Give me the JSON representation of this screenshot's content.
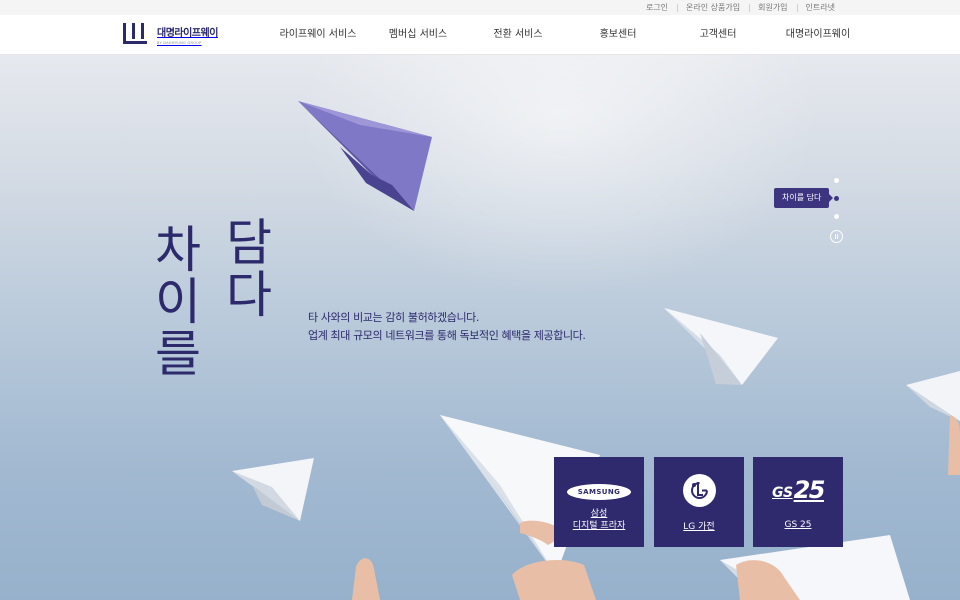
{
  "util_links": [
    "로그인",
    "온라인 상품가입",
    "회원가입",
    "인트라넷"
  ],
  "logo": {
    "text": "대명라이프웨이",
    "sub": "BY DAEMYUNG GROUP"
  },
  "gnb": [
    "라이프웨이 서비스",
    "멤버십 서비스",
    "전환 서비스",
    "홍보센터",
    "고객센터",
    "대명라이프웨이"
  ],
  "hero": {
    "title_right": [
      "담",
      "다"
    ],
    "title_left": [
      "차",
      "이",
      "를"
    ],
    "desc_line1": "타 사와의 비교는 감히 불허하겠습니다.",
    "desc_line2": "업계 최대 규모의 네트워크를 통해 독보적인 혜택을 제공합니다."
  },
  "pager": {
    "active_label": "차이를 담다",
    "dots": 3,
    "active_index": 1
  },
  "partners": [
    {
      "logo": "SAMSUNG",
      "label1": "삼성",
      "label2": "디지털 프라자"
    },
    {
      "logo": "LG",
      "label1": "LG 가전",
      "label2": ""
    },
    {
      "logo_gs": "GS",
      "logo_num": "25",
      "label1": "GS 25",
      "label2": ""
    }
  ],
  "colors": {
    "brand": "#2e2a6d",
    "accent": "#3d3580"
  }
}
